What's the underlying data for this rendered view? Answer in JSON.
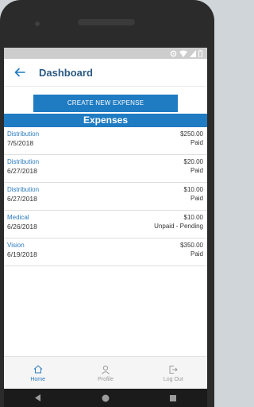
{
  "colors": {
    "accent": "#1f7bc2",
    "title": "#2b5a82",
    "link": "#2b7bbf"
  },
  "appbar": {
    "title": "Dashboard",
    "back_icon": "arrow-left-icon"
  },
  "create_button": {
    "label": "CREATE NEW EXPENSE"
  },
  "section": {
    "title": "Expenses"
  },
  "expenses": [
    {
      "category": "Distribution",
      "date": "7/5/2018",
      "amount": "$250.00",
      "status": "Paid"
    },
    {
      "category": "Distribution",
      "date": "6/27/2018",
      "amount": "$20.00",
      "status": "Paid"
    },
    {
      "category": "Distribution",
      "date": "6/27/2018",
      "amount": "$10.00",
      "status": "Paid"
    },
    {
      "category": "Medical",
      "date": "6/26/2018",
      "amount": "$10.00",
      "status": "Unpaid - Pending"
    },
    {
      "category": "Vision",
      "date": "6/19/2018",
      "amount": "$350.00",
      "status": "Paid"
    }
  ],
  "tabs": [
    {
      "label": "Home",
      "icon": "home-icon",
      "active": true
    },
    {
      "label": "Profile",
      "icon": "person-icon",
      "active": false
    },
    {
      "label": "Log Out",
      "icon": "logout-icon",
      "active": false
    }
  ]
}
